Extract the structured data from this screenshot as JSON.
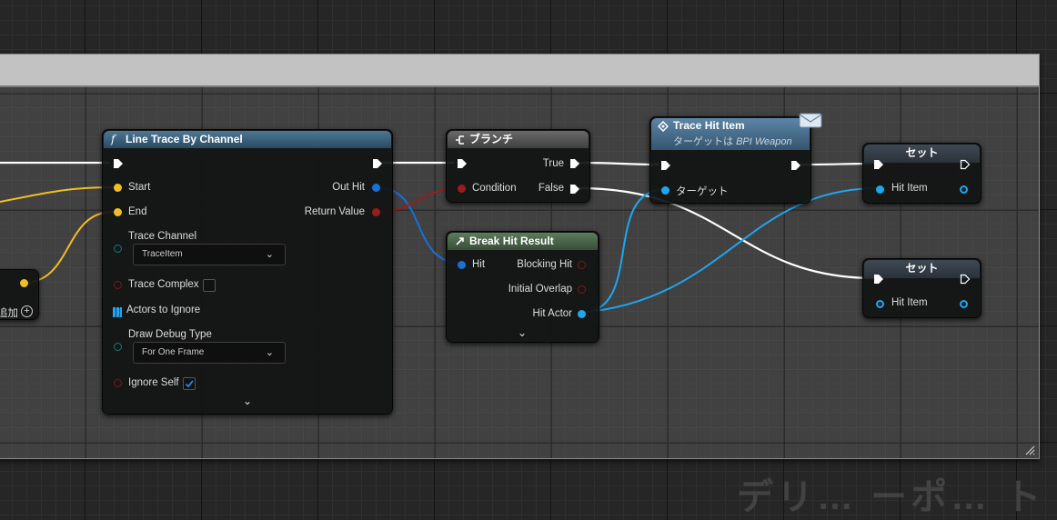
{
  "background_watermark": "デリ… ーポ… ト",
  "left_fragment": {
    "label": "追加"
  },
  "line_trace": {
    "title": "Line Trace By Channel",
    "icon": "f",
    "inputs": {
      "start": "Start",
      "end": "End",
      "trace_channel": "Trace Channel",
      "trace_complex": "Trace Complex",
      "actors_to_ignore": "Actors to Ignore",
      "draw_debug_type": "Draw Debug Type",
      "ignore_self": "Ignore Self"
    },
    "outputs": {
      "out_hit": "Out Hit",
      "return_value": "Return Value"
    },
    "trace_channel_value": "TraceItem",
    "draw_debug_value": "For One Frame",
    "trace_complex_checked": false,
    "ignore_self_checked": true
  },
  "branch": {
    "title": "ブランチ",
    "condition": "Condition",
    "true_label": "True",
    "false_label": "False"
  },
  "break_hit": {
    "title": "Break Hit Result",
    "hit": "Hit",
    "blocking_hit": "Blocking Hit",
    "initial_overlap": "Initial Overlap",
    "hit_actor": "Hit Actor"
  },
  "trace_hit_item": {
    "title": "Trace Hit Item",
    "subtitle": "ターゲットは ",
    "subtitle_target": "BPI Weapon",
    "target_pin": "ターゲット"
  },
  "set1": {
    "title": "セット",
    "pin": "Hit Item"
  },
  "set2": {
    "title": "セット",
    "pin": "Hit Item"
  },
  "colors": {
    "exec": "#ffffff",
    "vector": "#f5c020",
    "struct_hit": "#1a6fd6",
    "bool": "#8c1a1a",
    "object": "#1ea6f0",
    "byte": "#127a72",
    "array": "#1ea6f0"
  }
}
